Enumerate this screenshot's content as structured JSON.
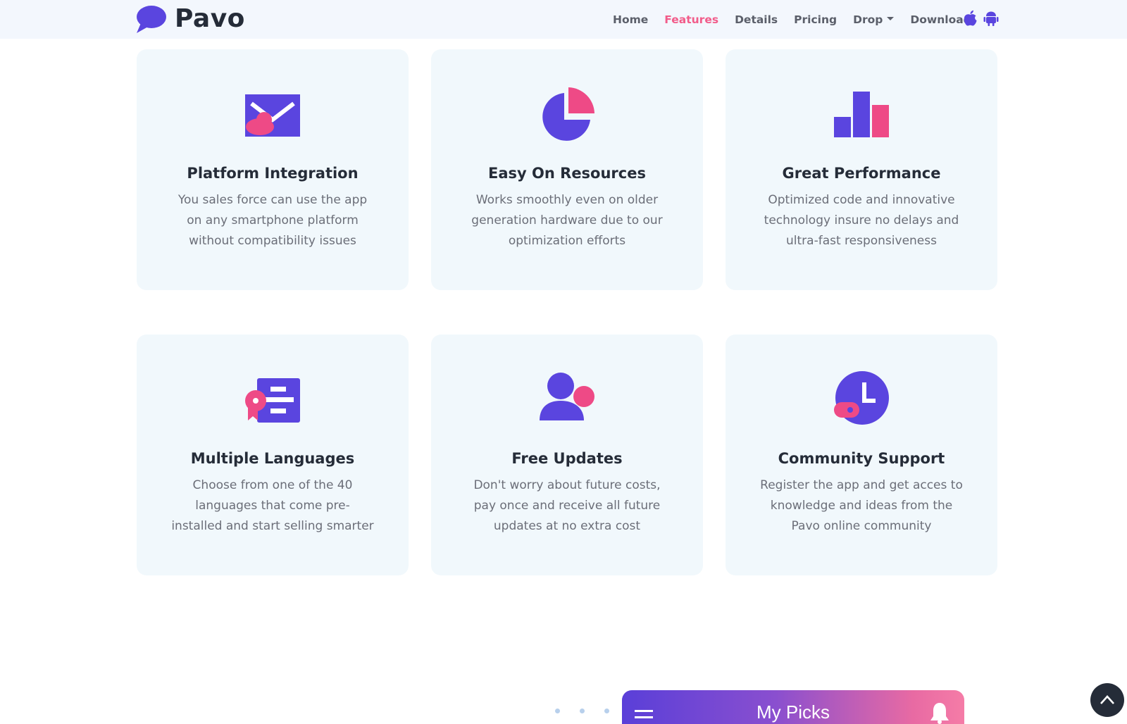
{
  "brand": {
    "name": "Pavo",
    "logo_icon": "speech-bubble-icon"
  },
  "nav": {
    "items": [
      {
        "label": "Home",
        "active": false
      },
      {
        "label": "Features",
        "active": true
      },
      {
        "label": "Details",
        "active": false
      },
      {
        "label": "Pricing",
        "active": false
      },
      {
        "label": "Drop",
        "active": false,
        "dropdown": true
      },
      {
        "label": "Download",
        "active": false
      }
    ],
    "store_icons": [
      "apple-icon",
      "android-icon"
    ]
  },
  "features": [
    {
      "icon": "envelope-icon",
      "title": "Platform Integration",
      "text": "You sales force can use the app on any smartphone platform without compatibility issues"
    },
    {
      "icon": "pie-chart-icon",
      "title": "Easy On Resources",
      "text": "Works smoothly even on older generation hardware due to our optimization efforts"
    },
    {
      "icon": "bar-chart-icon",
      "title": "Great Performance",
      "text": "Optimized code and innovative technology insure no delays and ultra-fast responsiveness"
    },
    {
      "icon": "certificate-icon",
      "title": "Multiple Languages",
      "text": "Choose from one of the 40 languages that come pre-installed and start selling smarter"
    },
    {
      "icon": "user-icon",
      "title": "Free Updates",
      "text": "Don't worry about future costs, pay once and receive all future updates at no extra cost"
    },
    {
      "icon": "clock-icon",
      "title": "Community Support",
      "text": "Register the app and get acces to knowledge and ideas from the Pavo online community"
    }
  ],
  "phone_preview": {
    "title": "My Picks",
    "left_icon": "menu-icon",
    "right_icon": "bell-icon"
  },
  "colors": {
    "primary": "#5a45df",
    "accent": "#ee4a86",
    "card_bg": "#f1f8fc",
    "nav_bg": "#f3f7fd"
  }
}
